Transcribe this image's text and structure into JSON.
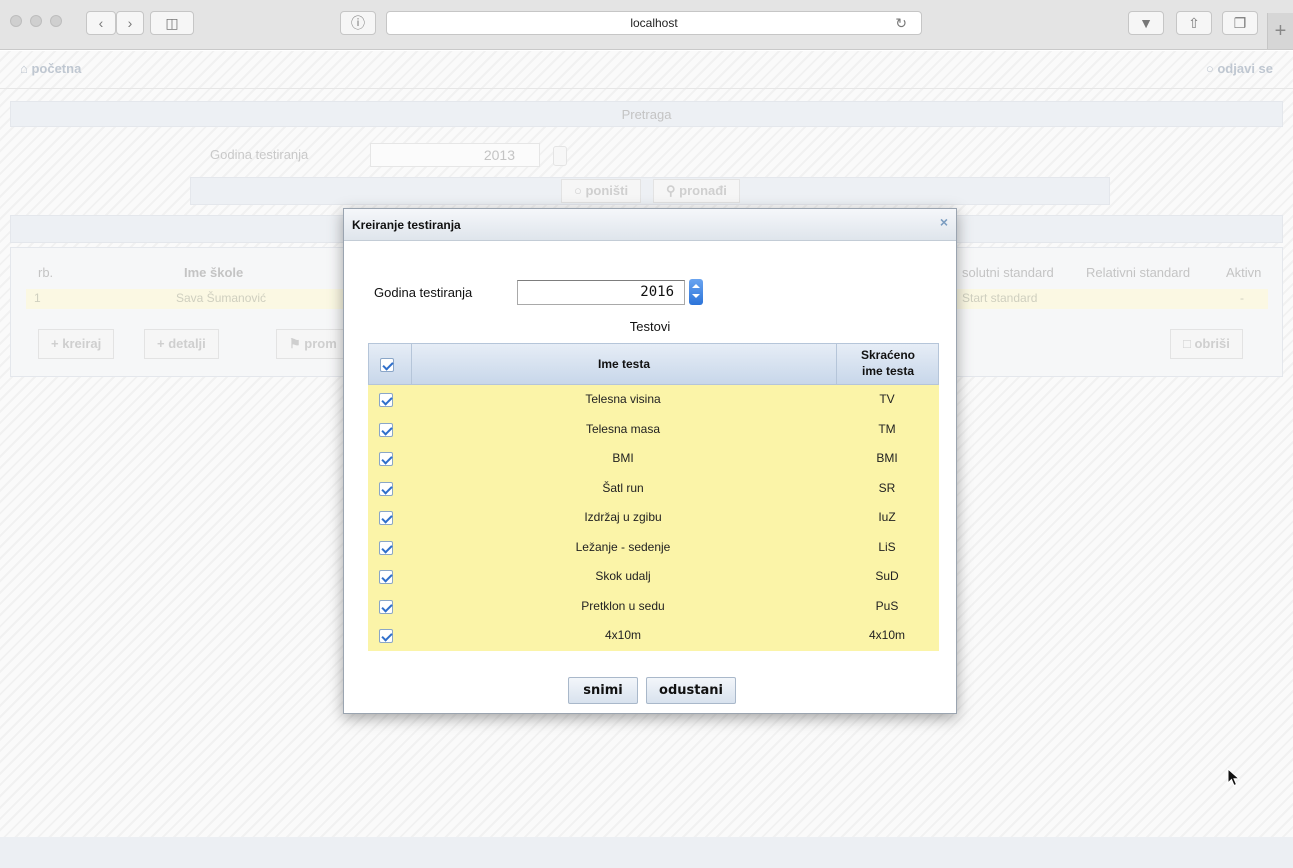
{
  "browser": {
    "url": "localhost"
  },
  "background": {
    "nav_home": "početna",
    "nav_logout": "odjavi se",
    "search_section_title": "Pretraga",
    "search_label": "Godina testiranja",
    "search_value": "2013",
    "reset_label": "poništi",
    "find_label": "pronađi",
    "table_headers": [
      "rb.",
      "Ime škole",
      "solutni standard",
      "Relativni standard",
      "Aktivn"
    ],
    "table_row": {
      "rb": "1",
      "school": "Sava Šumanović",
      "standard": "Start standard",
      "active": "-"
    },
    "actions": {
      "create": "kreiraj",
      "details": "detalji",
      "change": "prom",
      "delete": "obriši"
    }
  },
  "dialog": {
    "title": "Kreiranje testiranja",
    "close": "×",
    "year_label": "Godina testiranja",
    "year_value": "2016",
    "tests_caption": "Testovi",
    "columns": {
      "name": "Ime testa",
      "abbr_line1": "Skraćeno",
      "abbr_line2": "ime testa"
    },
    "rows": [
      {
        "name": "Telesna visina",
        "abbr": "TV",
        "checked": true
      },
      {
        "name": "Telesna masa",
        "abbr": "TM",
        "checked": true
      },
      {
        "name": "BMI",
        "abbr": "BMI",
        "checked": true
      },
      {
        "name": "Šatl run",
        "abbr": "SR",
        "checked": true
      },
      {
        "name": "Izdržaj u zgibu",
        "abbr": "IuZ",
        "checked": true
      },
      {
        "name": "Ležanje - sedenje",
        "abbr": "LiS",
        "checked": true
      },
      {
        "name": "Skok udalj",
        "abbr": "SuD",
        "checked": true
      },
      {
        "name": "Pretklon u sedu",
        "abbr": "PuS",
        "checked": true
      },
      {
        "name": "4x10m",
        "abbr": "4x10m",
        "checked": true
      }
    ],
    "save_label": "snimi",
    "cancel_label": "odustani"
  }
}
